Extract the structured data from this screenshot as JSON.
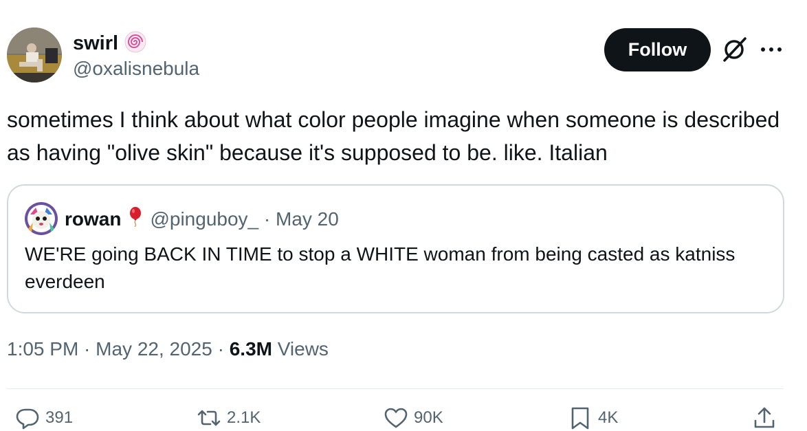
{
  "author": {
    "name": "swirl",
    "handle": "@oxalisnebula",
    "avatar_icon": "profile-photo",
    "badge_icon": "swirl-emoji"
  },
  "follow_label": "Follow",
  "tweet_text": "sometimes I think about what color people imagine when someone is described as having \"olive skin\" because it's supposed to be. like. Italian",
  "quoted": {
    "name": "rowan",
    "badge_icon": "red-balloon-emoji",
    "handle_date": "@pinguboy_ · May 20",
    "text": "WE'RE going BACK IN TIME to stop a WHITE woman from being casted as katniss everdeen"
  },
  "meta": {
    "time_date": "1:05 PM · May 22, 2025 · ",
    "views_count": "6.3M",
    "views_label": " Views"
  },
  "actions": {
    "replies": "391",
    "reposts": "2.1K",
    "likes": "90K",
    "bookmarks": "4K"
  },
  "colors": {
    "text": "#0f1419",
    "secondary": "#536471",
    "border": "#cfd9de",
    "button_bg": "#0f1419"
  }
}
